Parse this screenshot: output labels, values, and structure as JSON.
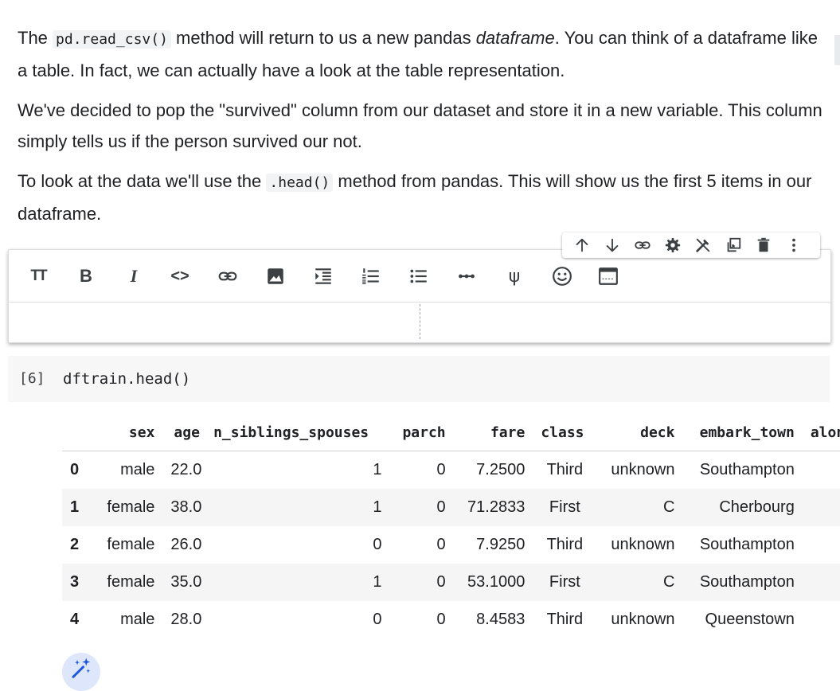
{
  "text_cell": {
    "p1_a": "The ",
    "p1_code": "pd.read_csv()",
    "p1_b": " method will return to us a new pandas ",
    "p1_em": "dataframe",
    "p1_c": ". You can think of a dataframe like a table. In fact, we can actually have a look at the table representation.",
    "p2": "We've decided to pop the \"survived\" column from our dataset and store it in a new variable. This column simply tells us if the person survived our not.",
    "p3_a": "To look at the data we'll use the ",
    "p3_code": ".head()",
    "p3_b": " method from pandas. This will show us the first 5 items in our dataframe."
  },
  "cell_toolbar": {
    "icons": [
      "arrow-up-icon",
      "arrow-down-icon",
      "link-icon",
      "gear-icon",
      "edit-off-icon",
      "mirror-cell-icon",
      "delete-icon",
      "more-vert-icon"
    ]
  },
  "format_bar": {
    "heading_label": "TT",
    "bold_label": "B",
    "italic_label": "I",
    "code_label": "<>",
    "latex_label": "ψ"
  },
  "code_cell": {
    "exec_count": "[6]",
    "code": "dftrain.head()"
  },
  "dataframe": {
    "columns": [
      "",
      "sex",
      "age",
      "n_siblings_spouses",
      "parch",
      "fare",
      "class",
      "deck",
      "embark_town",
      "alone"
    ],
    "rows": [
      [
        "0",
        "male",
        "22.0",
        "1",
        "0",
        "7.2500",
        "Third",
        "unknown",
        "Southampton",
        ""
      ],
      [
        "1",
        "female",
        "38.0",
        "1",
        "0",
        "71.2833",
        "First",
        "C",
        "Cherbourg",
        ""
      ],
      [
        "2",
        "female",
        "26.0",
        "0",
        "0",
        "7.9250",
        "Third",
        "unknown",
        "Southampton",
        ""
      ],
      [
        "3",
        "female",
        "35.0",
        "1",
        "0",
        "53.1000",
        "First",
        "C",
        "Southampton",
        ""
      ],
      [
        "4",
        "male",
        "28.0",
        "0",
        "0",
        "8.4583",
        "Third",
        "unknown",
        "Queenstown",
        ""
      ]
    ]
  },
  "colors": {
    "accent": "#1a73e8",
    "row_stripe": "#f5f5f5",
    "code_cell_bg": "#f7f7f7",
    "magic_bg": "#dde6fb"
  }
}
